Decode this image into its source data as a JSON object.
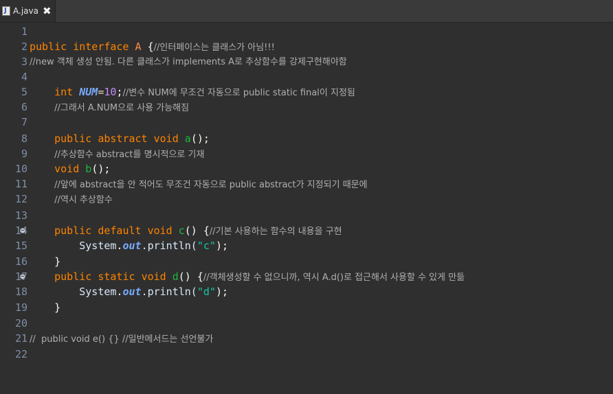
{
  "tab": {
    "icon": "java-file-icon",
    "filename": "A.java",
    "close_glyph": "✖"
  },
  "lines": {
    "l1": {
      "num": "1"
    },
    "l2": {
      "num": "2",
      "t1": "public",
      "t2": "interface",
      "t3": "A",
      "t4": "{",
      "c": "//인터페이스는 클래스가 아님!!!"
    },
    "l3": {
      "num": "3",
      "c": "//new 객체 생성 안됨. 다른 클래스가 implements A로 추상함수를 강제구현해야함"
    },
    "l4": {
      "num": "4"
    },
    "l5": {
      "num": "5",
      "t1": "int",
      "t2": "NUM",
      "t3": "=",
      "t4": "10",
      "t5": ";",
      "c": "//변수 NUM에 무조건 자동으로 public static final이 지정됨"
    },
    "l6": {
      "num": "6",
      "c": "//그래서 A.NUM으로 사용 가능해짐"
    },
    "l7": {
      "num": "7"
    },
    "l8": {
      "num": "8",
      "t1": "public",
      "t2": "abstract",
      "t3": "void",
      "t4": "a",
      "t5": "();"
    },
    "l9": {
      "num": "9",
      "c": "//추상함수 abstract를 명시적으로 기재"
    },
    "l10": {
      "num": "10",
      "t1": "void",
      "t2": "b",
      "t3": "();"
    },
    "l11": {
      "num": "11",
      "c": "//앞에 abstract을 안 적어도 무조건 자동으로 public abstract가 지정되기 때문에"
    },
    "l12": {
      "num": "12",
      "c": "//역시 추상함수"
    },
    "l13": {
      "num": "13"
    },
    "l14": {
      "num": "14",
      "t1": "public",
      "t2": "default",
      "t3": "void",
      "t4": "c",
      "t5": "() {",
      "c": "//기본 사용하는 함수의 내용을 구현"
    },
    "l15": {
      "num": "15",
      "t1": "System",
      "t2": ".",
      "t3": "out",
      "t4": ".println(",
      "t5": "\"c\"",
      "t6": ");"
    },
    "l16": {
      "num": "16",
      "t1": "}"
    },
    "l17": {
      "num": "17",
      "t1": "public",
      "t2": "static",
      "t3": "void",
      "t4": "d",
      "t5": "() {",
      "c": "//객체생성할 수 없으니까, 역시 A.d()로 접근해서 사용할 수 있게 만듦"
    },
    "l18": {
      "num": "18",
      "t1": "System",
      "t2": ".",
      "t3": "out",
      "t4": ".println(",
      "t5": "\"d\"",
      "t6": ");"
    },
    "l19": {
      "num": "19",
      "t1": "}"
    },
    "l20": {
      "num": "20"
    },
    "l21": {
      "num": "21",
      "c": "//  public void e() {} //일반메서드는 선언불가"
    },
    "l22": {
      "num": "22"
    }
  },
  "colors": {
    "background": "#2f2f2f",
    "keyword": "#ff8400",
    "comment": "#b0b0b0",
    "method": "#1eb540",
    "string": "#17c6a3",
    "number": "#c48cff",
    "field": "#79abff",
    "line_number": "#7f8fa8"
  }
}
